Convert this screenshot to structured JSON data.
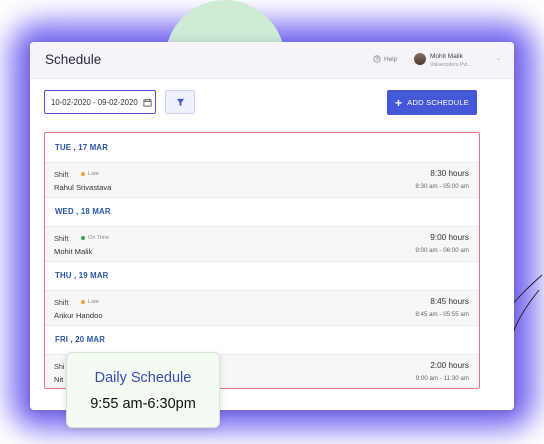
{
  "header": {
    "title": "Schedule",
    "help_label": "Help",
    "user_name": "Mohit Malik",
    "user_org": "Valuecoders Pvt..."
  },
  "toolbar": {
    "date_range": "10-02-2020 - 09-02-2020",
    "add_schedule_label": "ADD SCHEDULE"
  },
  "days": [
    {
      "date": "TUE , 17 MAR",
      "shift_label": "Shift",
      "status": "Late",
      "status_color": "#f0a030",
      "person": "Rahul Srivastava",
      "hours": "8:30 hours",
      "time_range": "8:30 am - 05:00 am"
    },
    {
      "date": "WED , 18 MAR",
      "shift_label": "Shift",
      "status": "On Time",
      "status_color": "#3aa655",
      "person": "Mohit Malik",
      "hours": "9:00 hours",
      "time_range": "9:00 am - 06:00 am"
    },
    {
      "date": "THU , 19 MAR",
      "shift_label": "Shift",
      "status": "Late",
      "status_color": "#f0a030",
      "person": "Ankur Handoo",
      "hours": "8:45 hours",
      "time_range": "8:45 am - 05:55 am"
    },
    {
      "date": "FRI , 20 MAR",
      "shift_label": "Shi",
      "status": "",
      "status_color": "#f0a030",
      "person": "Nit",
      "hours": "2:00 hours",
      "time_range": "9:00 am - 11:30 am"
    }
  ],
  "tooltip": {
    "title": "Daily Schedule",
    "time": "9:55 am-6:30pm"
  },
  "colors": {
    "accent": "#4457d6",
    "date_heading": "#2855a8",
    "list_border": "#e27a86"
  }
}
